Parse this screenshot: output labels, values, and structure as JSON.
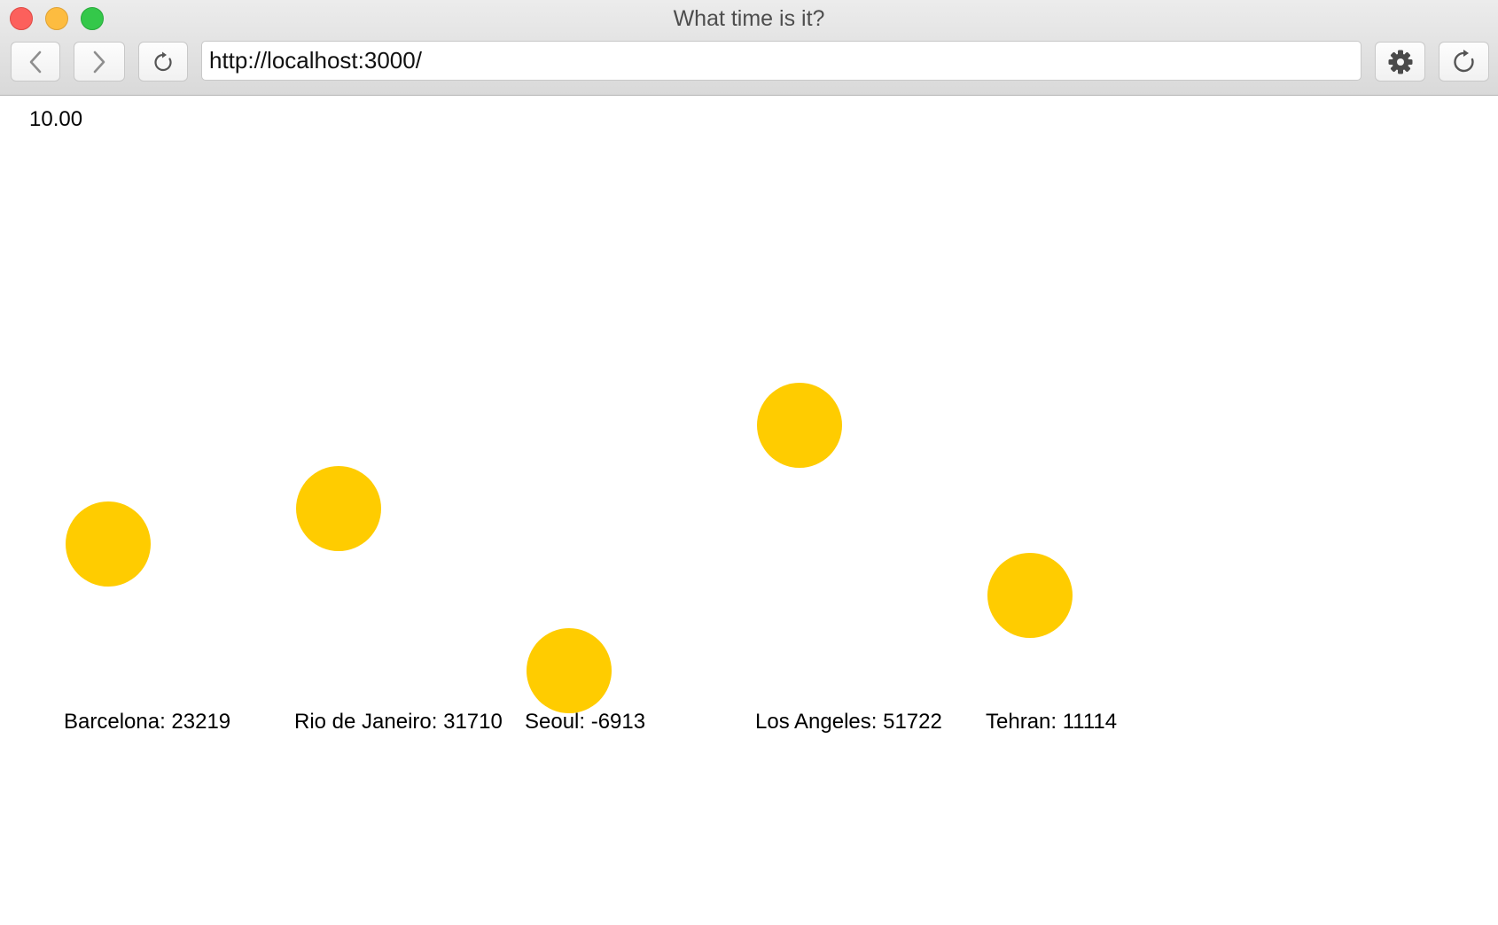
{
  "window": {
    "title": "What time is it?"
  },
  "toolbar": {
    "back_icon": "chevron-left-icon",
    "forward_icon": "chevron-right-icon",
    "reload_icon": "reload-icon",
    "settings_icon": "gear-icon",
    "refresh_icon": "refresh-icon"
  },
  "address_bar": {
    "url": "http://localhost:3000/"
  },
  "page": {
    "counter": "10.00",
    "sun_color": "#ffcc00",
    "cities": [
      {
        "name": "Barcelona",
        "value": 23219,
        "label": "Barcelona: 23219"
      },
      {
        "name": "Rio de Janeiro",
        "value": 31710,
        "label": "Rio de Janeiro: 31710"
      },
      {
        "name": "Seoul",
        "value": -6913,
        "label": "Seoul: -6913"
      },
      {
        "name": "Los Angeles",
        "value": 51722,
        "label": "Los Angeles: 51722"
      },
      {
        "name": "Tehran",
        "value": 11114,
        "label": "Tehran: 11114"
      }
    ]
  }
}
